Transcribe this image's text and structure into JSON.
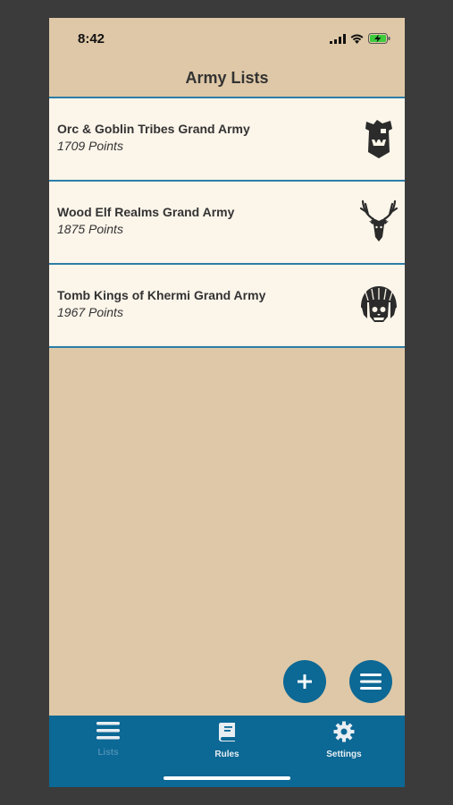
{
  "status_bar": {
    "time": "8:42"
  },
  "header": {
    "title": "Army Lists"
  },
  "lists": [
    {
      "name": "Orc & Goblin Tribes Grand Army",
      "points": "1709 Points",
      "icon": "orc-head-icon"
    },
    {
      "name": "Wood Elf Realms Grand Army",
      "points": "1875 Points",
      "icon": "stag-head-icon"
    },
    {
      "name": "Tomb Kings of Khermi Grand Army",
      "points": "1967 Points",
      "icon": "skull-headdress-icon"
    }
  ],
  "tab_bar": {
    "tabs": [
      {
        "label": "Lists",
        "icon": "list-icon",
        "color": "#4a8fb3"
      },
      {
        "label": "Rules",
        "icon": "book-icon",
        "color": "#e8eef2"
      },
      {
        "label": "Settings",
        "icon": "gear-icon",
        "color": "#e8eef2"
      }
    ]
  },
  "colors": {
    "background": "#dfc8a7",
    "card": "#fcf5ea",
    "accent": "#0c6895",
    "divider": "#2c7ea7"
  }
}
